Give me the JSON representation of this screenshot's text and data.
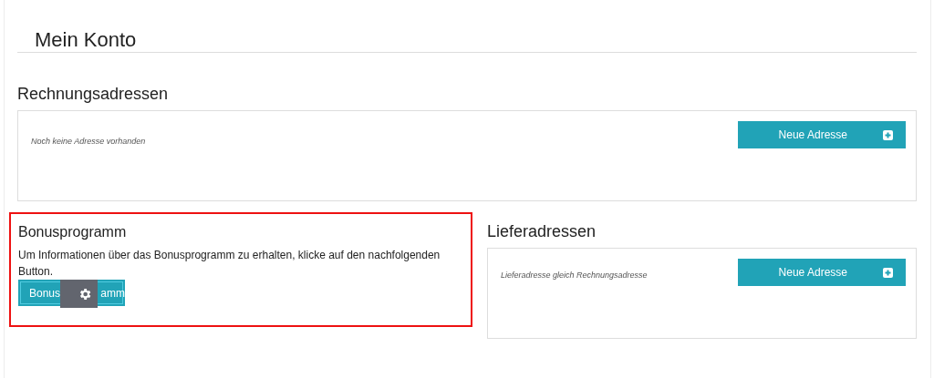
{
  "page": {
    "title": "Mein Konto"
  },
  "billing": {
    "title": "Rechnungsadressen",
    "empty_text": "Noch keine Adresse vorhanden",
    "button": "Neue Adresse"
  },
  "bonus": {
    "title": "Bonusprogramm",
    "text": "Um Informationen über das Bonusprogramm zu erhalten, klicke auf den nachfolgenden Button.",
    "button_parts": [
      "Bonus",
      "amm"
    ],
    "highlighted": true
  },
  "shipping": {
    "title": "Lieferadressen",
    "text": "Lieferadresse gleich Rechnungsadresse",
    "button": "Neue Adresse"
  }
}
